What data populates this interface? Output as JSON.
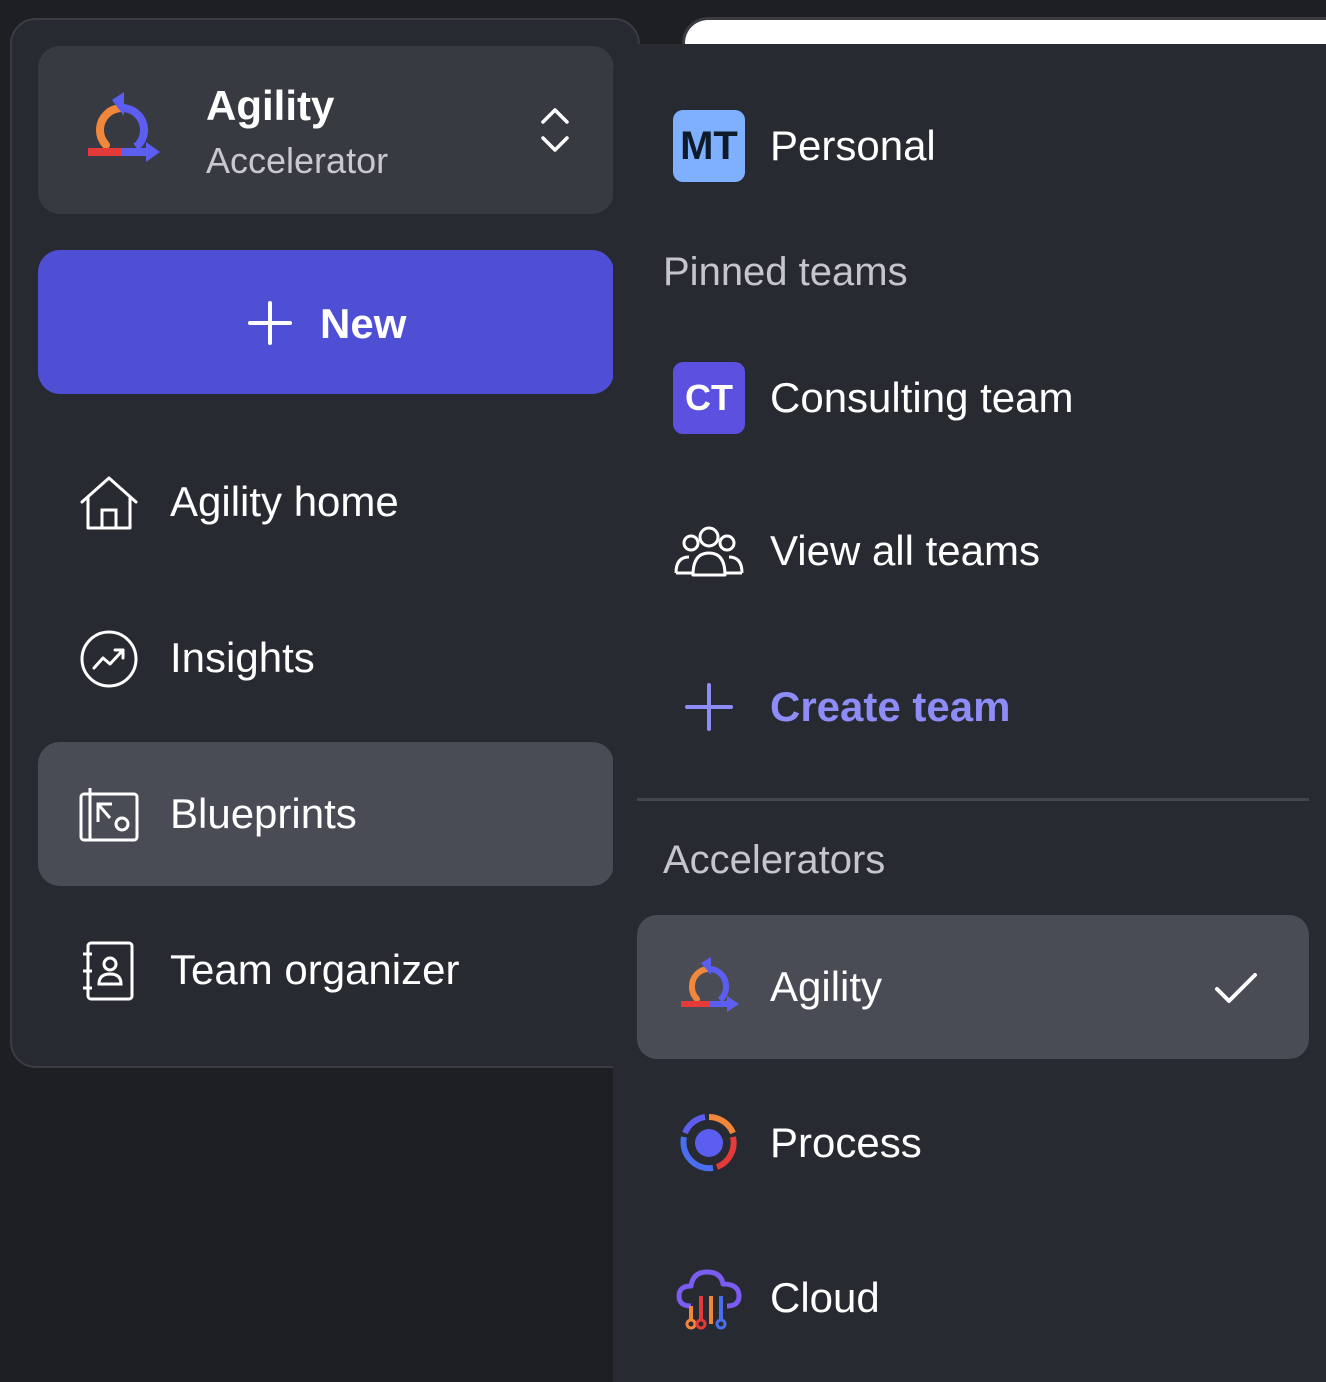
{
  "switcher": {
    "title": "Agility",
    "subtitle": "Accelerator"
  },
  "new_button": {
    "label": "New"
  },
  "nav": {
    "items": [
      {
        "label": "Agility home",
        "icon": "home-icon"
      },
      {
        "label": "Insights",
        "icon": "trending-up-icon"
      },
      {
        "label": "Blueprints",
        "icon": "blueprint-icon",
        "active": true
      },
      {
        "label": "Team organizer",
        "icon": "contact-book-icon"
      }
    ]
  },
  "dropdown": {
    "personal": {
      "avatar": "MT",
      "label": "Personal",
      "avatar_color": "#7fb0ff"
    },
    "pinned_heading": "Pinned teams",
    "pinned": [
      {
        "avatar": "CT",
        "label": "Consulting team",
        "avatar_color": "#5b50e0"
      }
    ],
    "view_all": {
      "label": "View all teams"
    },
    "create": {
      "label": "Create team"
    },
    "accelerators_heading": "Accelerators",
    "accelerators": [
      {
        "label": "Agility",
        "icon": "agility-logo-icon",
        "selected": true
      },
      {
        "label": "Process",
        "icon": "process-logo-icon"
      },
      {
        "label": "Cloud",
        "icon": "cloud-logo-icon"
      }
    ]
  },
  "colors": {
    "accent": "#4f4fd6",
    "link": "#8e8cf6",
    "panel": "#282a31",
    "selected": "#494b55"
  }
}
